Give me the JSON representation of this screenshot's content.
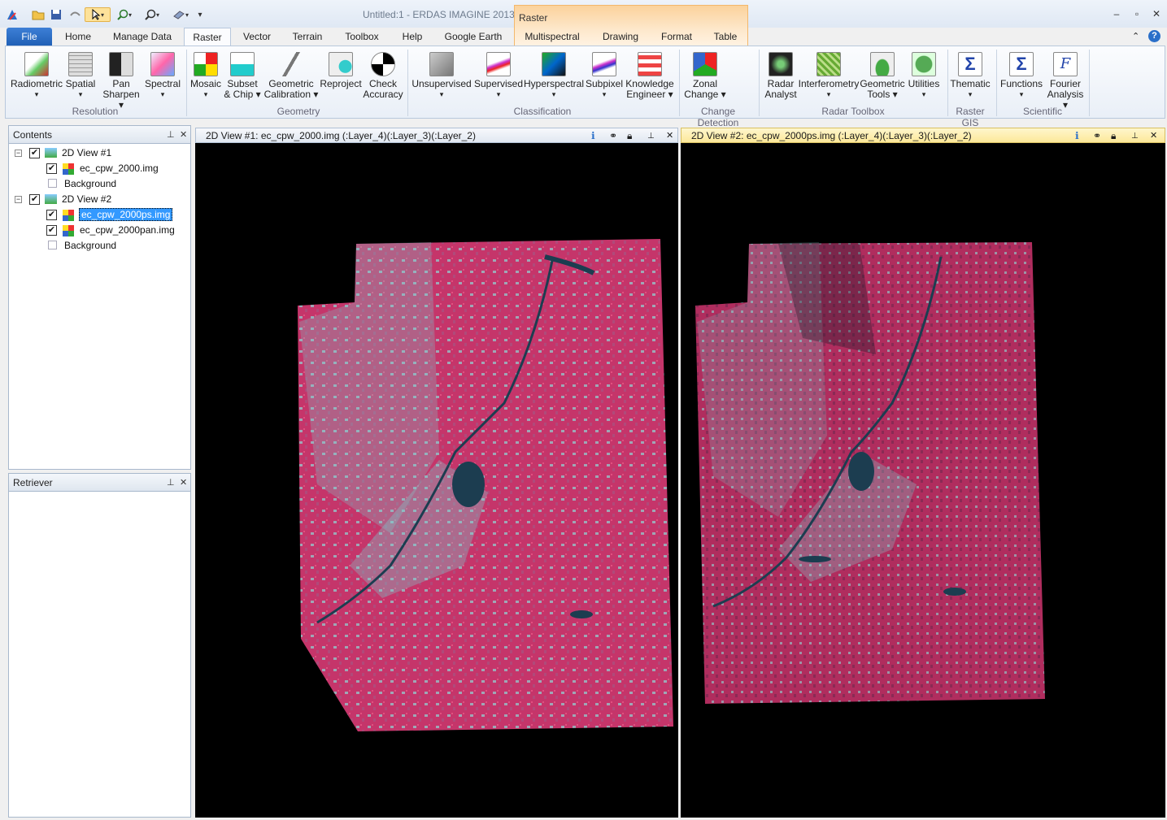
{
  "window": {
    "title": "Untitled:1 - ERDAS IMAGINE 2013",
    "context_group": "Raster"
  },
  "qat": {
    "icons": [
      "app-logo-icon",
      "open-folder-icon",
      "save-icon",
      "undo-icon",
      "select-pointer-icon",
      "zoom-in-icon",
      "zoom-out-icon",
      "eraser-icon",
      "customize-icon"
    ]
  },
  "tabs": [
    "File",
    "Home",
    "Manage Data",
    "Raster",
    "Vector",
    "Terrain",
    "Toolbox",
    "Help",
    "Google Earth",
    "Multispectral",
    "Drawing",
    "Format",
    "Table"
  ],
  "ribbon": {
    "groups": [
      {
        "name": "Resolution",
        "buttons": [
          {
            "l1": "Radiometric",
            "l2": "▾"
          },
          {
            "l1": "Spatial",
            "l2": "▾"
          },
          {
            "l1": "Pan",
            "l2": "Sharpen ▾"
          },
          {
            "l1": "Spectral",
            "l2": "▾"
          }
        ]
      },
      {
        "name": "Geometry",
        "buttons": [
          {
            "l1": "Mosaic",
            "l2": "▾"
          },
          {
            "l1": "Subset",
            "l2": "& Chip ▾"
          },
          {
            "l1": "Geometric",
            "l2": "Calibration ▾"
          },
          {
            "l1": "Reproject",
            "l2": ""
          },
          {
            "l1": "Check",
            "l2": "Accuracy"
          }
        ]
      },
      {
        "name": "Classification",
        "buttons": [
          {
            "l1": "Unsupervised",
            "l2": "▾"
          },
          {
            "l1": "Supervised",
            "l2": "▾"
          },
          {
            "l1": "Hyperspectral",
            "l2": "▾"
          },
          {
            "l1": "Subpixel",
            "l2": "▾"
          },
          {
            "l1": "Knowledge",
            "l2": "Engineer ▾"
          }
        ]
      },
      {
        "name": "Change Detection",
        "buttons": [
          {
            "l1": "Zonal",
            "l2": "Change ▾"
          }
        ]
      },
      {
        "name": "Radar Toolbox",
        "buttons": [
          {
            "l1": "Radar",
            "l2": "Analyst"
          },
          {
            "l1": "Interferometry",
            "l2": "▾"
          },
          {
            "l1": "Geometric",
            "l2": "Tools ▾"
          },
          {
            "l1": "Utilities",
            "l2": "▾"
          }
        ]
      },
      {
        "name": "Raster GIS",
        "buttons": [
          {
            "l1": "Thematic",
            "l2": "▾"
          }
        ]
      },
      {
        "name": "Scientific",
        "buttons": [
          {
            "l1": "Functions",
            "l2": "▾"
          },
          {
            "l1": "Fourier",
            "l2": "Analysis ▾"
          }
        ]
      }
    ]
  },
  "contents": {
    "title": "Contents",
    "tree": [
      {
        "label": "2D View #1",
        "children": [
          {
            "label": "ec_cpw_2000.img",
            "checked": true
          },
          {
            "label": "Background",
            "checked": false
          }
        ]
      },
      {
        "label": "2D View #2",
        "children": [
          {
            "label": "ec_cpw_2000ps.img",
            "checked": true,
            "selected": true
          },
          {
            "label": "ec_cpw_2000pan.img",
            "checked": true
          },
          {
            "label": "Background",
            "checked": false
          }
        ]
      }
    ]
  },
  "retriever": {
    "title": "Retriever"
  },
  "views": [
    {
      "title": "2D View #1: ec_cpw_2000.img (:Layer_4)(:Layer_3)(:Layer_2)",
      "active": false
    },
    {
      "title": "2D View #2: ec_cpw_2000ps.img (:Layer_4)(:Layer_3)(:Layer_2)",
      "active": true
    }
  ],
  "colors": {
    "accent": "#1f5fb5",
    "context_orange": "#fbd29c",
    "image_red": "#c8326a",
    "image_cyan": "#7fd3d3",
    "water": "#1c3d50"
  }
}
